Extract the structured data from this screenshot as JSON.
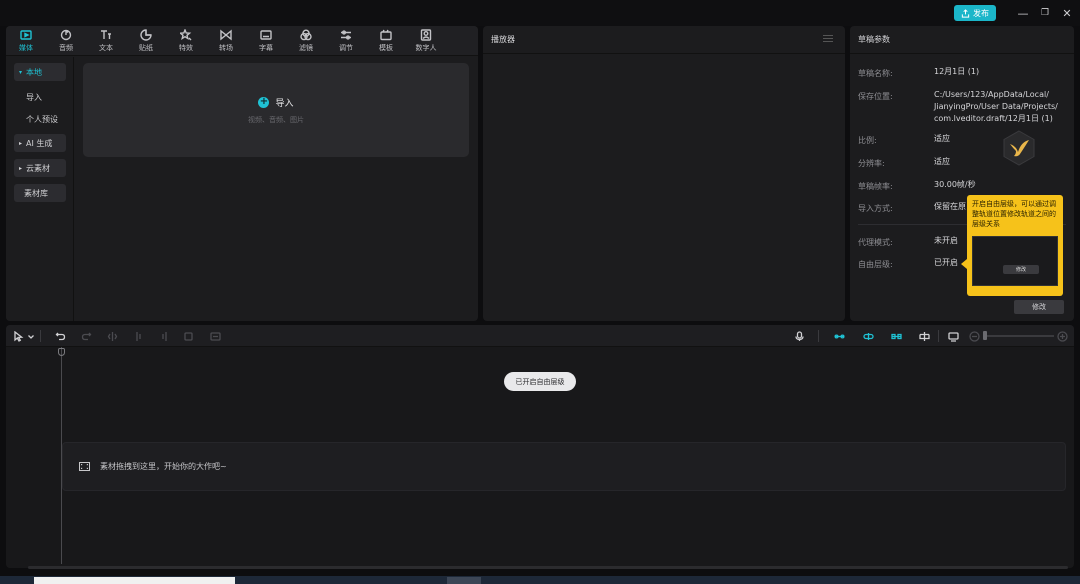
{
  "titlebar": {
    "publish_label": "发布",
    "controls": [
      "—",
      "❐",
      "✕"
    ]
  },
  "toolbar": {
    "tools": [
      {
        "label": "媒体",
        "icon": "media-icon",
        "active": true
      },
      {
        "label": "音频",
        "icon": "audio-icon"
      },
      {
        "label": "文本",
        "icon": "text-icon"
      },
      {
        "label": "贴纸",
        "icon": "sticker-icon"
      },
      {
        "label": "特效",
        "icon": "effects-icon"
      },
      {
        "label": "转场",
        "icon": "transition-icon"
      },
      {
        "label": "字幕",
        "icon": "caption-icon"
      },
      {
        "label": "滤镜",
        "icon": "filter-icon"
      },
      {
        "label": "调节",
        "icon": "adjust-icon"
      },
      {
        "label": "模板",
        "icon": "template-icon"
      },
      {
        "label": "数字人",
        "icon": "digital-human-icon"
      }
    ]
  },
  "sidebar": {
    "items": [
      {
        "label": "本地",
        "active": true
      },
      {
        "label": "导入"
      },
      {
        "label": "个人预设"
      },
      {
        "label": "AI 生成"
      },
      {
        "label": "云素材"
      },
      {
        "label": "素材库"
      }
    ]
  },
  "import_area": {
    "label": "导入",
    "hint": "视频、音频、图片"
  },
  "player": {
    "title": "播放器"
  },
  "draft": {
    "title": "草稿参数",
    "fields": [
      {
        "key": "草稿名称:",
        "value": "12月1日 (1)"
      },
      {
        "key": "保存位置:",
        "value_lines": [
          "C:/Users/123/AppData/Local/",
          "JianyingPro/User Data/Projects/",
          "com.lveditor.draft/12月1日 (1)"
        ]
      },
      {
        "key": "比例:",
        "value": "适应"
      },
      {
        "key": "分辨率:",
        "value": "适应"
      },
      {
        "key": "草稿帧率:",
        "value": "30.00帧/秒"
      },
      {
        "key": "导入方式:",
        "value": "保留在原"
      },
      {
        "key": "代理模式:",
        "value": "未开启"
      },
      {
        "key": "自由层级:",
        "value": "已开启"
      }
    ],
    "modify_label": "修改"
  },
  "tooltip": {
    "text": "开启自由层级，可以通过调整轨道位置修改轨道之间的层级关系",
    "preview_button": "修改"
  },
  "timeline": {
    "free_layer_label": "已开启自由层级",
    "drop_hint": "素材拖拽到这里，开始你的大作吧~"
  },
  "colors": {
    "accent": "#1fc2d4",
    "tooltip": "#f6c21a",
    "publish": "#1bb6c9"
  }
}
